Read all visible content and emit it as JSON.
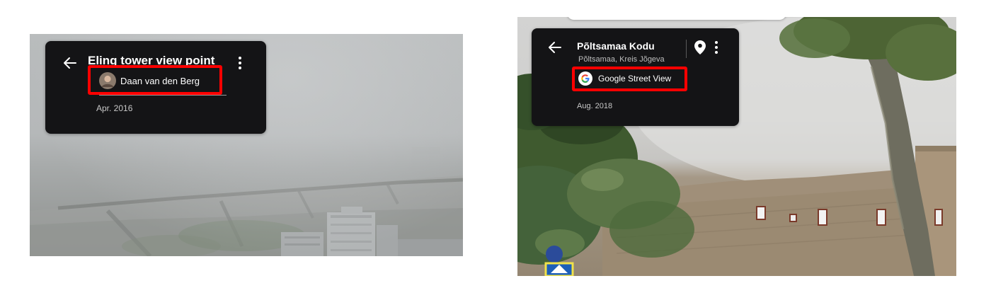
{
  "left_panel": {
    "title": "Eling tower view point",
    "author": "Daan van den Berg",
    "date": "Apr. 2016",
    "avatar_icon": "person-avatar-icon",
    "back_icon": "arrow-back-icon",
    "more_icon": "more-vert-icon"
  },
  "right_panel": {
    "title": "Põltsamaa Kodu",
    "subtitle": "Põltsamaa, Kreis Jõgeva",
    "author": "Google Street View",
    "date": "Aug. 2018",
    "avatar_icon": "google-logo-icon",
    "back_icon": "arrow-back-icon",
    "pin_icon": "map-pin-icon",
    "more_icon": "more-vert-icon"
  },
  "colors": {
    "card_bg": "#141416",
    "highlight": "#ff0000",
    "text_primary": "#ffffff",
    "text_secondary": "#bdbdbd"
  }
}
